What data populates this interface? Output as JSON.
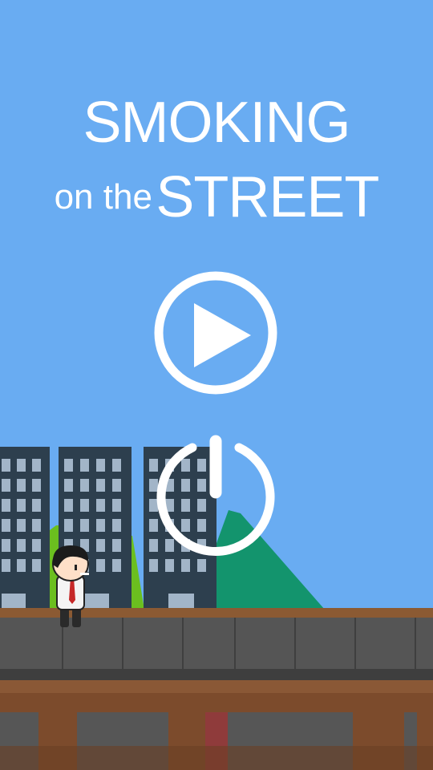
{
  "title": {
    "line1": "SMOKING",
    "line2_prefix": "on the",
    "line2_main": "STREET"
  },
  "buttons": {
    "play_icon": "play-icon",
    "power_icon": "power-icon"
  },
  "colors": {
    "sky": "#69acf2",
    "building": "#2d3f4e",
    "window": "#a2b5c8",
    "mountain_green": "#13946d",
    "hill_lime": "#6bbf1f",
    "sidewalk_top": "#8b5a33",
    "sidewalk": "#545454",
    "ground_brown": "#7c4b2c",
    "button_white": "#ffffff"
  }
}
